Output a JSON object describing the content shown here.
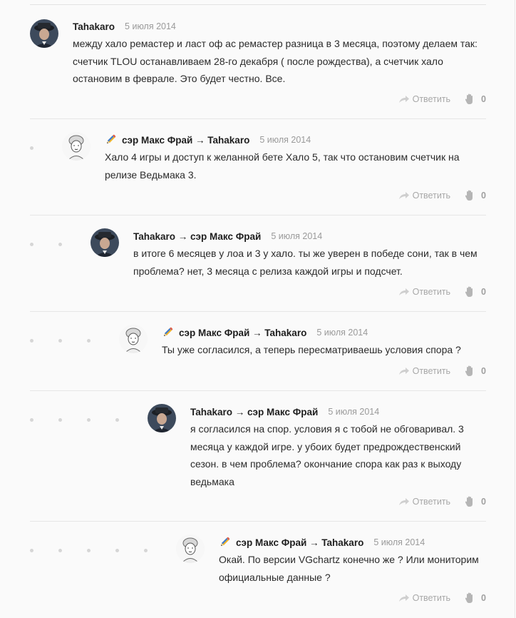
{
  "comments": [
    {
      "author": "Tahakaro",
      "date": "5 июля 2014",
      "text": "между хало ремастер и ласт оф ас ремастер разница в 3 месяца, поэтому делаем так: счетчик TLOU останавливаем 28-го декабря ( после рождества), а счетчик хало остановим в феврале. Это будет честно. Все.",
      "reply_label": "Ответить",
      "likes": "0"
    },
    {
      "author": "сэр Макс Фрай → Tahakaro",
      "date": "5 июля 2014",
      "text": "Хало 4 игры и доступ к желанной бете Хало 5, так что остановим счетчик на релизе Ведьмака 3.",
      "reply_label": "Ответить",
      "likes": "0"
    },
    {
      "author": "Tahakaro → сэр Макс Фрай",
      "date": "5 июля 2014",
      "text": "в итоге 6 месяцев у лоа и 3 у хало. ты же уверен в победе сони, так в чем проблема? нет, 3 месяца с релиза каждой игры и подсчет.",
      "reply_label": "Ответить",
      "likes": "0"
    },
    {
      "author": "сэр Макс Фрай → Tahakaro",
      "date": "5 июля 2014",
      "text": "Ты уже согласился, а теперь пересматриваешь условия спора ?",
      "reply_label": "Ответить",
      "likes": "0"
    },
    {
      "author": "Tahakaro → сэр Макс Фрай",
      "date": "5 июля 2014",
      "text": "я согласился на спор. условия я с тобой не обговаривал. 3 месяца у каждой игре. у убоих будет предрождественский сезон. в чем проблема? окончание спора как раз к выходу ведьмака",
      "reply_label": "Ответить",
      "likes": "0"
    },
    {
      "author": "сэр Макс Фрай → Tahakaro",
      "date": "5 июля 2014",
      "text": "Окай. По версии VGchartz конечно же ? Или мониторим официальные данные ?",
      "reply_label": "Ответить",
      "likes": "0"
    }
  ]
}
